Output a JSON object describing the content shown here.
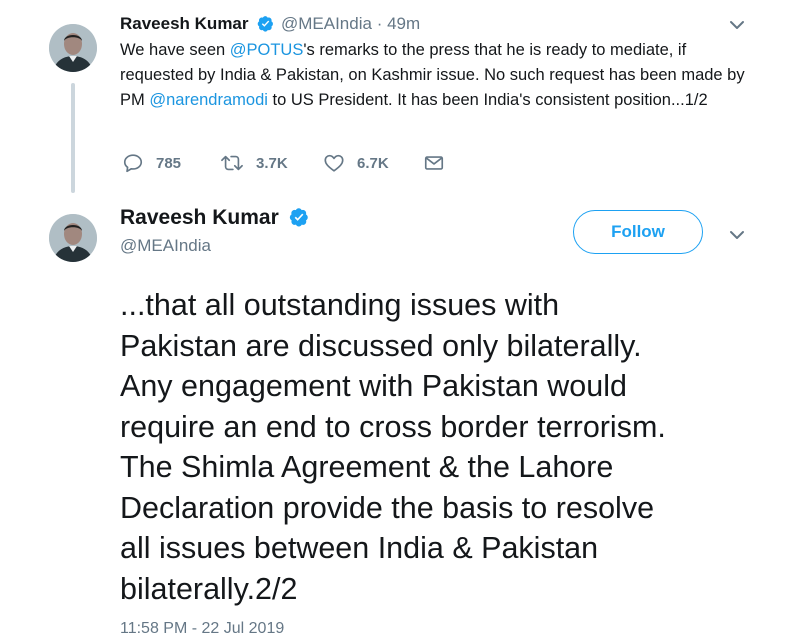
{
  "tweet1": {
    "author_name": "Raveesh Kumar",
    "handle": "@MEAIndia",
    "separator": "·",
    "time": "49m",
    "text_parts": {
      "p1": "We have seen ",
      "m1": "@POTUS",
      "p2": "'s remarks to the press that he is ready to mediate, if requested by India & Pakistan, on Kashmir issue. No such request has been made by PM ",
      "m2": "@narendramodi",
      "p3": " to US President. It has been India's consistent position...1/2"
    },
    "actions": {
      "reply_count": "785",
      "retweet_count": "3.7K",
      "like_count": "6.7K"
    }
  },
  "tweet2": {
    "author_name": "Raveesh Kumar",
    "handle": "@MEAIndia",
    "follow_label": "Follow",
    "text_lines": [
      "...that all outstanding issues with",
      "Pakistan are discussed only bilaterally.",
      "Any engagement with Pakistan would",
      "require an end to cross border terrorism.",
      "The Shimla Agreement & the Lahore",
      "Declaration provide the basis to resolve",
      "all issues between India & Pakistan",
      "bilaterally.2/2"
    ],
    "timestamp": "11:58 PM - 22 Jul 2019"
  },
  "colors": {
    "accent": "#1da1f2",
    "mention": "#1b95e0",
    "secondary_text": "#657786",
    "thread_line": "#ccd6dd"
  },
  "icons": {
    "verified": "verified-badge-icon",
    "reply": "reply-icon",
    "retweet": "retweet-icon",
    "like": "heart-icon",
    "dm": "envelope-icon",
    "more": "chevron-down-icon"
  }
}
